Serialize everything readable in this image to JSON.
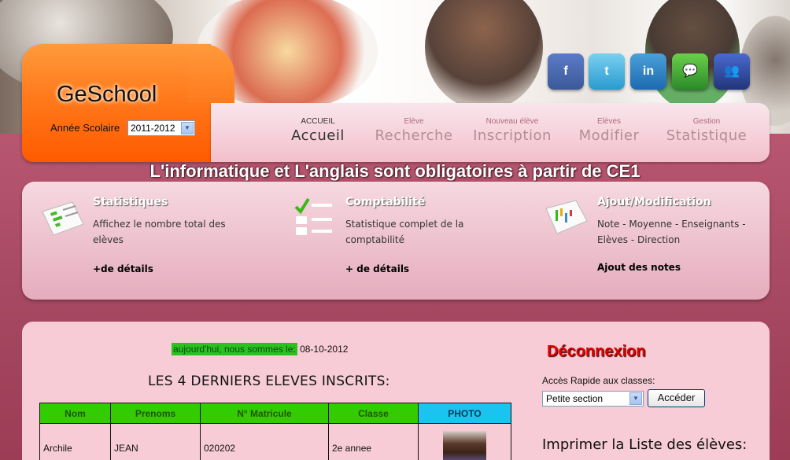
{
  "header": {
    "logo": "GeSchool",
    "year_label": "Année Scolaire",
    "year_value": "2011-2012",
    "social": [
      {
        "name": "facebook-icon",
        "glyph": "f",
        "color": "#3b5998"
      },
      {
        "name": "twitter-icon",
        "glyph": "t",
        "color": "#33aadd"
      },
      {
        "name": "linkedin-icon",
        "glyph": "in",
        "color": "#1d7ab6"
      },
      {
        "name": "chat-icon",
        "glyph": "💬",
        "color": "#3a9a2a"
      },
      {
        "name": "messenger-icon",
        "glyph": "👥",
        "color": "#2a4a9a"
      }
    ]
  },
  "nav": [
    {
      "small": "ACCUEIL",
      "big": "Accueil",
      "active": true
    },
    {
      "small": "Elève",
      "big": "Recherche"
    },
    {
      "small": "Nouveau élève",
      "big": "Inscription"
    },
    {
      "small": "Elèves",
      "big": "Modifier"
    },
    {
      "small": "Gestion",
      "big": "Statistique"
    }
  ],
  "tagline": "L'informatique et L'anglais sont obligatoires à partir de CE1",
  "features": [
    {
      "title": "Statistiques",
      "desc": "Affichez le nombre total des elèves",
      "link": "+de détails"
    },
    {
      "title": "Comptabilité",
      "desc": "Statistique complet de la comptabilité",
      "link": "+ de détails"
    },
    {
      "title": "Ajout/Modification",
      "desc": "Note - Moyenne - Enseignants - Elèves - Direction",
      "link": "Ajout des notes"
    }
  ],
  "today": {
    "label": "aujourd'hui, nous sommes le:",
    "date": "08-10-2012"
  },
  "latest_title": "LES 4 DERNIERS ELEVES INSCRITS:",
  "table": {
    "headers": [
      "Nom",
      "Prenoms",
      "N° Matricule",
      "Classe",
      "PHOTO"
    ],
    "rows": [
      [
        "Archile",
        "JEAN",
        "020202",
        "2e annee",
        ""
      ]
    ]
  },
  "sidebar": {
    "logout": "Déconnexion",
    "quick_label": "Accès Rapide aux classes:",
    "class_value": "Petite section",
    "go_label": "Accéder",
    "print_title": "Imprimer la Liste des élèves:"
  }
}
